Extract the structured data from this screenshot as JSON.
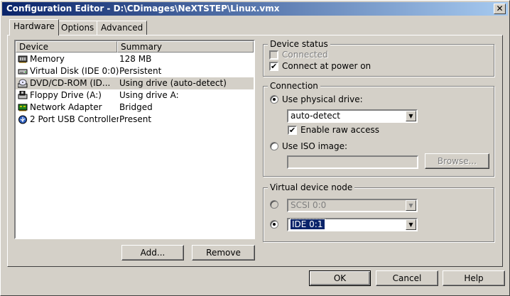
{
  "window": {
    "title": "Configuration Editor - D:\\CDimages\\NeXTSTEP\\Linux.vmx",
    "close_glyph": "✕"
  },
  "tabs": [
    "Hardware",
    "Options",
    "Advanced"
  ],
  "device_list": {
    "columns": [
      "Device",
      "Summary"
    ],
    "rows": [
      {
        "device": "Memory",
        "summary": "128 MB",
        "icon": "memory-icon"
      },
      {
        "device": "Virtual Disk (IDE 0:0)",
        "summary": "Persistent",
        "icon": "hard-disk-icon"
      },
      {
        "device": "DVD/CD-ROM (ID...",
        "summary": "Using drive (auto-detect)",
        "icon": "cdrom-icon"
      },
      {
        "device": "Floppy Drive (A:)",
        "summary": "Using drive A:",
        "icon": "floppy-icon"
      },
      {
        "device": "Network Adapter",
        "summary": "Bridged",
        "icon": "network-icon"
      },
      {
        "device": "2 Port USB Controller",
        "summary": "Present",
        "icon": "usb-icon"
      }
    ],
    "selected_index": 2
  },
  "buttons": {
    "add": "Add...",
    "remove": "Remove",
    "ok": "OK",
    "cancel": "Cancel",
    "help": "Help",
    "browse": "Browse..."
  },
  "device_status": {
    "title": "Device status",
    "connected": "Connected",
    "connect_at_power_on": "Connect at power on",
    "check_mark": "✔"
  },
  "connection": {
    "title": "Connection",
    "use_physical_drive": "Use physical drive:",
    "drive_value": "auto-detect",
    "enable_raw_access": "Enable raw access",
    "use_iso_image": "Use ISO image:",
    "iso_value": ""
  },
  "virtual_device_node": {
    "title": "Virtual device node",
    "scsi_value": "SCSI 0:0",
    "ide_value": "IDE 0:1"
  },
  "glyphs": {
    "combo_arrow": "▼"
  },
  "colors": {
    "selection": "#0a246a",
    "face": "#d4d0c8",
    "title_start": "#0a246a",
    "title_end": "#a6caf0"
  }
}
